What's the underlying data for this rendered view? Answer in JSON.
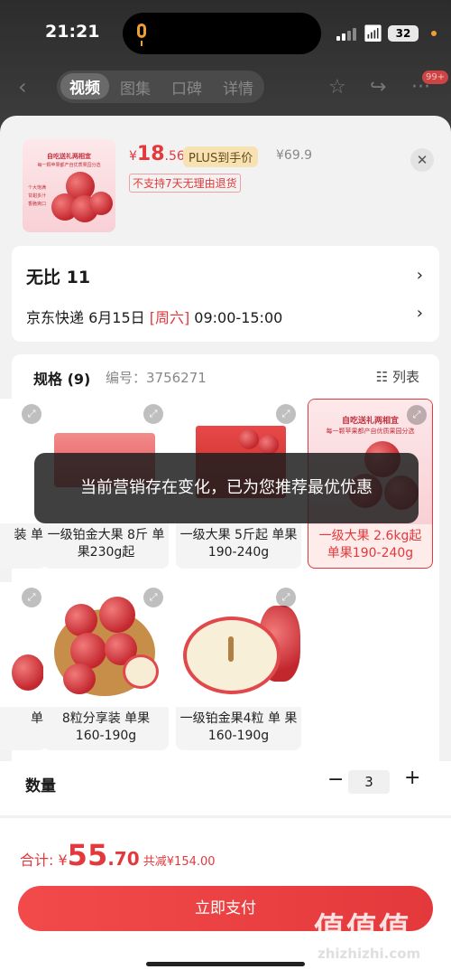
{
  "status": {
    "time": "21:21",
    "battery": "32"
  },
  "nav": {
    "tabs": [
      "视频",
      "图集",
      "口碑",
      "详情"
    ],
    "badge": "99+"
  },
  "product": {
    "thumb_title": "自吃送礼两相宜",
    "thumb_sub": "每一颗苹果都产自优质果园分选",
    "thumb_features": [
      "个大饱满",
      "甘甜多汁",
      "香脆爽口"
    ],
    "price_symbol": "¥",
    "price_int": "18",
    "price_dec": ".56",
    "plus_label": "PLUS到手价",
    "orig_price": "¥69.9",
    "return_note": "不支持7天无理由退货"
  },
  "address": {
    "name": "无比  11",
    "courier": "京东快递 6月15日 ",
    "day": "[周六]",
    "slot": " 09:00-15:00"
  },
  "spec": {
    "title": "规格 (9)",
    "code": "编号：3756271",
    "list_label": "列表"
  },
  "options": [
    {
      "label": "装  单"
    },
    {
      "label": "一级铂金大果 8斤 单果230g起"
    },
    {
      "label": "一级大果 5斤起  单果190-240g"
    },
    {
      "label": "一级大果 2.6kg起 单果190-240g",
      "box_title": "自吃送礼两相宜",
      "box_sub": "每一颗苹果都产自优质果园分选"
    },
    {
      "label": "单"
    },
    {
      "label": "8粒分享装  单果 160-190g"
    },
    {
      "label": "一级铂金果4粒 单 果160-190g"
    }
  ],
  "toast": "当前营销存在变化，已为您推荐最优优惠",
  "quantity": {
    "label": "数量",
    "value": "3"
  },
  "footer": {
    "total_label": "合计: ¥",
    "total_int": "55",
    "total_dec": ".70",
    "save": " 共减¥154.00",
    "pay": "立即支付"
  },
  "watermark": {
    "main": "值值值",
    "sub": "zhizhizhi.com"
  }
}
